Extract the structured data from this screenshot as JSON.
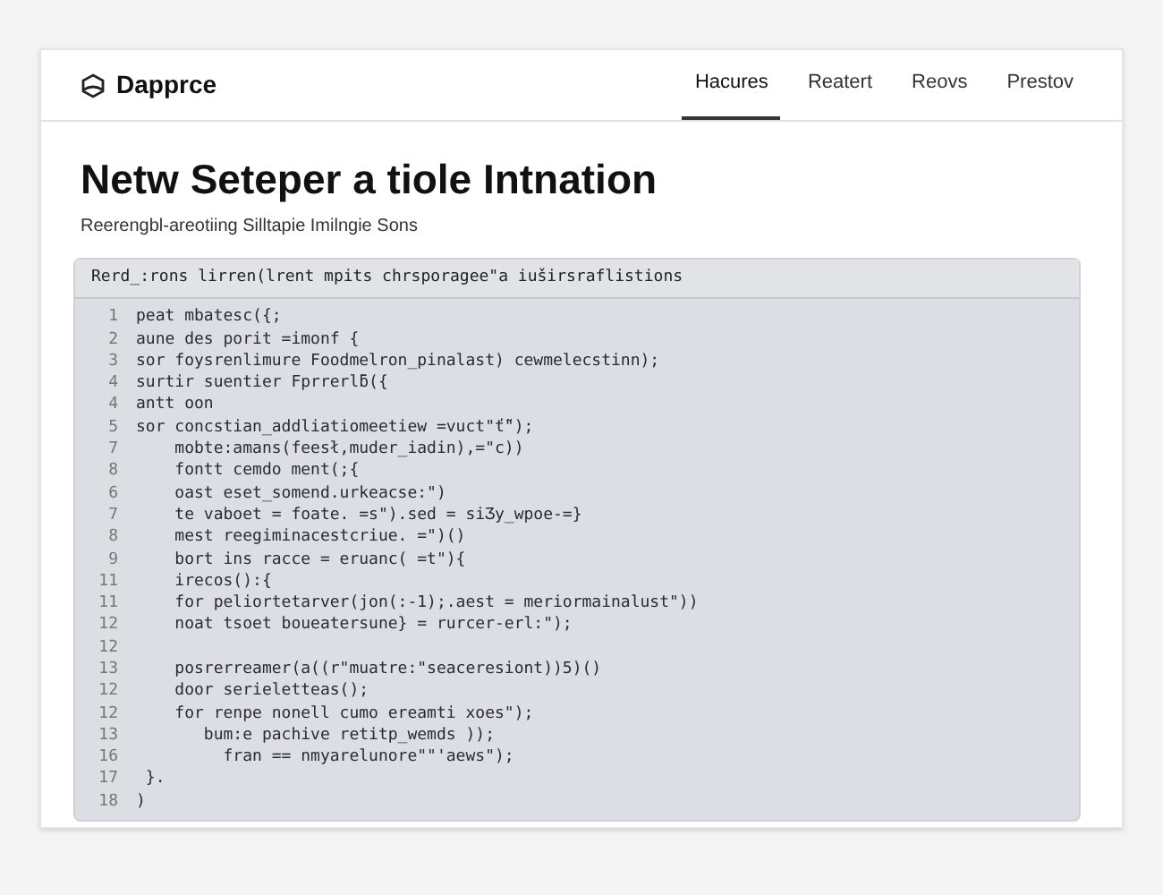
{
  "header": {
    "brand": "Dapprce",
    "tabs": [
      {
        "label": "Hacures",
        "selected": true
      },
      {
        "label": "Reatert",
        "selected": false
      },
      {
        "label": "Reovs",
        "selected": false
      },
      {
        "label": "Prestov",
        "selected": false
      }
    ]
  },
  "title": "Netw Seteper a tiole Intnation",
  "subtitle": "Reerengbl-areotiing Silltapie Imilngie Sons",
  "code": {
    "caption": "Rerd_:rons lirren(lrent mpits chrsporagee\"a iuširsraflistions",
    "lines": [
      {
        "num": "1",
        "text": "peat mbatesc({;"
      },
      {
        "num": "2",
        "text": "aune des porit =imonf {"
      },
      {
        "num": "3",
        "text": "sor foysrenlimure Foodmelron_pinalast) cewmelecstinn);"
      },
      {
        "num": "4",
        "text": "surtir suentier Fprrerlƃ({"
      },
      {
        "num": "4",
        "text": "antt oon"
      },
      {
        "num": "5",
        "text": "sor concstian_addliatiomeetiew =vuct\"ť̃\");"
      },
      {
        "num": "7",
        "text": "    mobte:amans(feesł,muder_iadin),=\"c))"
      },
      {
        "num": "8",
        "text": "    fontt cemdo ment(;{"
      },
      {
        "num": "6",
        "text": "    oast eset_somend.urkeacse:\")"
      },
      {
        "num": "7",
        "text": "    te vaboet = foate. =s\").sed = siƷy_wpoe-=}"
      },
      {
        "num": "8",
        "text": "    mest reegiminacestcriue. =\")()"
      },
      {
        "num": "9",
        "text": "    bort ins racce = eruanc( =t\"){"
      },
      {
        "num": "11",
        "text": "    irecos():{"
      },
      {
        "num": "11",
        "text": "    for peliortetarver(jon(:-1);.aest = meriormainalust\"))"
      },
      {
        "num": "12",
        "text": "    noat tsoet boueatersune} = rurcer-erl:\");"
      },
      {
        "num": "12"
      },
      {
        "num": "13",
        "text": "    posrerreamer(a((r\"muatre:\"seaceresiont))5)()"
      },
      {
        "num": "12",
        "text": "    door serieletteas();"
      },
      {
        "num": "12",
        "text": "    for renpe nonell cumo ereamti xoes\");"
      },
      {
        "num": "13",
        "text": "       bum:e pachive retitp_wemds ));"
      },
      {
        "num": "16",
        "text": "         fran == nmyarelunore\"\"'aews\");"
      },
      {
        "num": "17",
        "text": " }."
      },
      {
        "num": "18",
        "text": ")"
      }
    ]
  }
}
